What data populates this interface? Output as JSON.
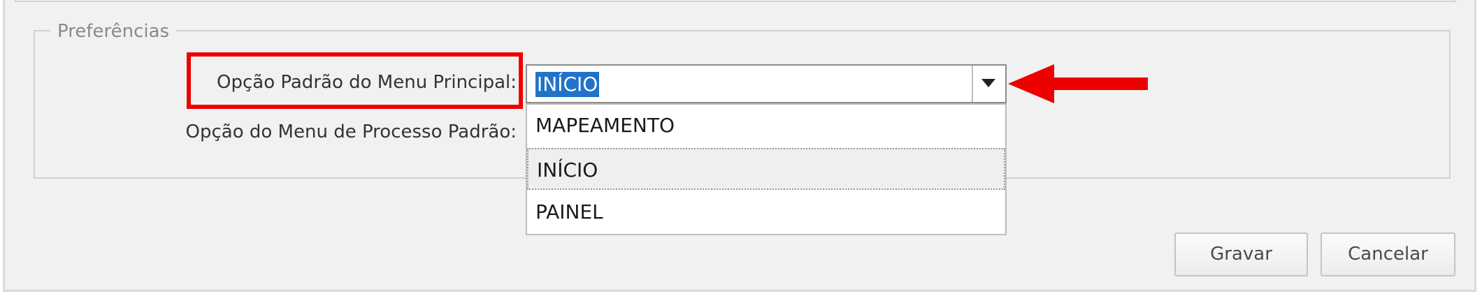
{
  "preferences": {
    "legend": "Preferências",
    "main_menu_label": "Opção Padrão do Menu Principal:",
    "process_menu_label": "Opção do Menu de Processo Padrão:",
    "main_menu_select": {
      "selected_value": "INÍCIO",
      "dropdown_icon": "chevron-down-icon",
      "options": [
        "MAPEAMENTO",
        "INÍCIO",
        "PAINEL"
      ]
    }
  },
  "annotations": {
    "highlight_color": "#ec0000",
    "arrow_icon": "arrow-left-icon"
  },
  "actions": {
    "save_label": "Gravar",
    "cancel_label": "Cancelar"
  },
  "colors": {
    "selection_highlight": "#1f73c9",
    "panel_background": "#f1f1f1"
  }
}
